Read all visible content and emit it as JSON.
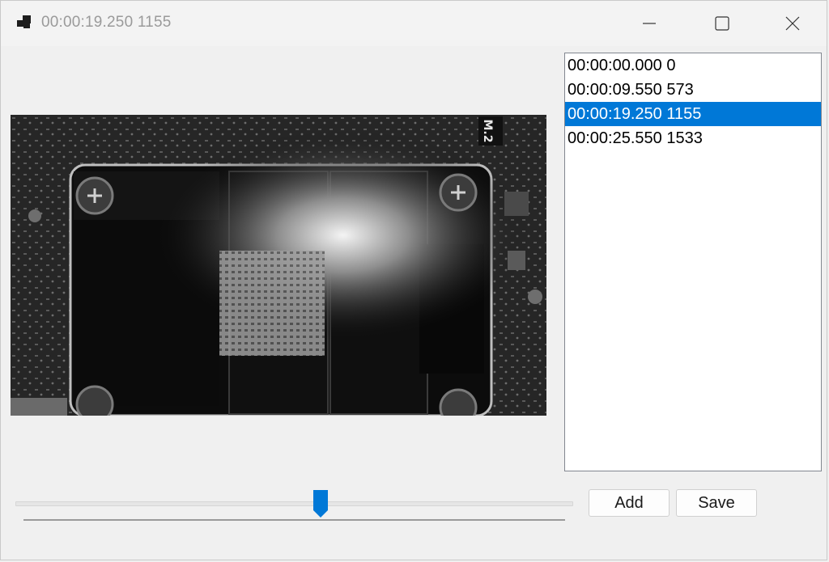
{
  "window": {
    "title": "00:00:19.250 1155",
    "controls": {
      "minimize": "minimize-icon",
      "maximize": "maximize-icon",
      "close": "close-icon"
    }
  },
  "video": {
    "description_icon": "video-frame",
    "silkscreen_label": "M.2"
  },
  "keyframes": {
    "items": [
      {
        "label": "00:00:00.000 0"
      },
      {
        "label": "00:00:09.550 573"
      },
      {
        "label": "00:00:19.250 1155"
      },
      {
        "label": "00:00:25.550 1533"
      }
    ],
    "selected_index": 2
  },
  "timeline": {
    "position_fraction": 0.548
  },
  "buttons": {
    "add_label": "Add",
    "save_label": "Save"
  },
  "colors": {
    "selection": "#0078d7",
    "thumb": "#0078d7"
  }
}
